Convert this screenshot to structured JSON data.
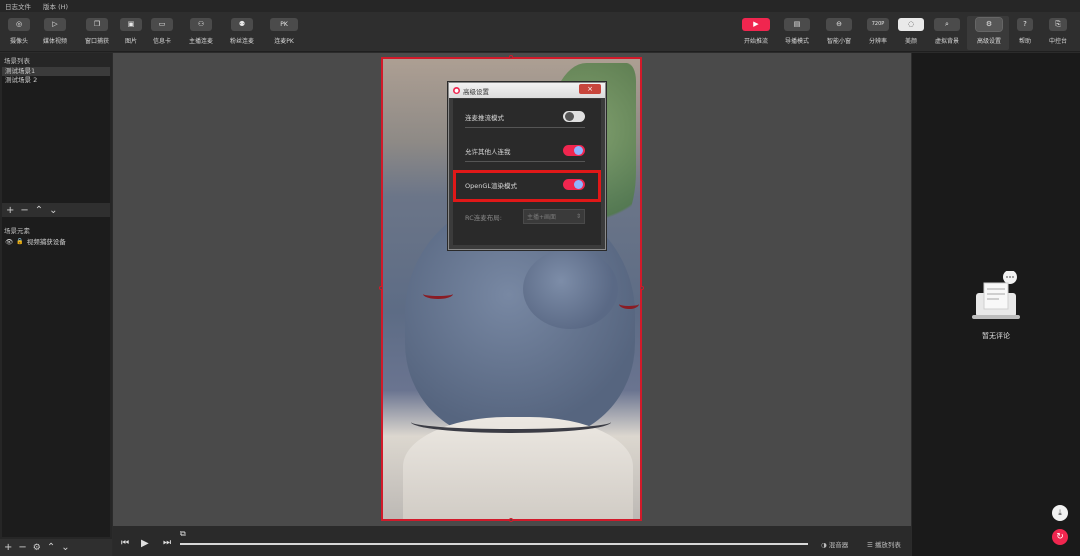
{
  "menubar": {
    "items": [
      "日志文件",
      "版本 (H)"
    ]
  },
  "toolbar": {
    "left": [
      {
        "label": "摄像头",
        "icon": "◎"
      },
      {
        "label": "媒体视频",
        "icon": "▷"
      },
      {
        "label": "窗口捕获",
        "icon": "❐"
      },
      {
        "label": "图片",
        "icon": "▣"
      },
      {
        "label": "信息卡",
        "icon": "▭"
      },
      {
        "label": "主播连麦",
        "icon": "⚇"
      },
      {
        "label": "粉丝连麦",
        "icon": "⚉"
      },
      {
        "label": "连麦PK",
        "icon": "PK"
      }
    ],
    "right": [
      {
        "label": "开始推流",
        "icon": "▶"
      },
      {
        "label": "导播模式",
        "icon": "▤"
      },
      {
        "label": "智能小窗",
        "icon": "⊖"
      },
      {
        "label": "分辨率",
        "icon": "720P"
      },
      {
        "label": "美颜",
        "icon": "◌"
      },
      {
        "label": "虚拟背景",
        "icon": "⌕"
      },
      {
        "label": "高级设置",
        "icon": "⚙"
      },
      {
        "label": "帮助",
        "icon": "?"
      },
      {
        "label": "中控台",
        "icon": "⎘"
      }
    ]
  },
  "scenes": {
    "title": "场景列表",
    "items": [
      "测试场景1",
      "测试场景 2"
    ]
  },
  "elements": {
    "title": "场景元素",
    "items": [
      "视频捕获设备"
    ]
  },
  "bottombar": {
    "mixer": "混音器",
    "playlist": "播放列表"
  },
  "comments": {
    "empty_text": "暂无评论"
  },
  "dialog": {
    "title": "高级设置",
    "close": "×",
    "options": [
      {
        "label": "连麦推流模式",
        "on": false
      },
      {
        "label": "允许其他人连我",
        "on": true
      },
      {
        "label": "OpenGL渲染模式",
        "on": true
      }
    ],
    "layout_label": "RC连麦布局:",
    "layout_value": "主播+画面"
  },
  "colors": {
    "accent": "#f0264f",
    "highlight": "#e01818",
    "preview_border": "#d11a2a"
  }
}
